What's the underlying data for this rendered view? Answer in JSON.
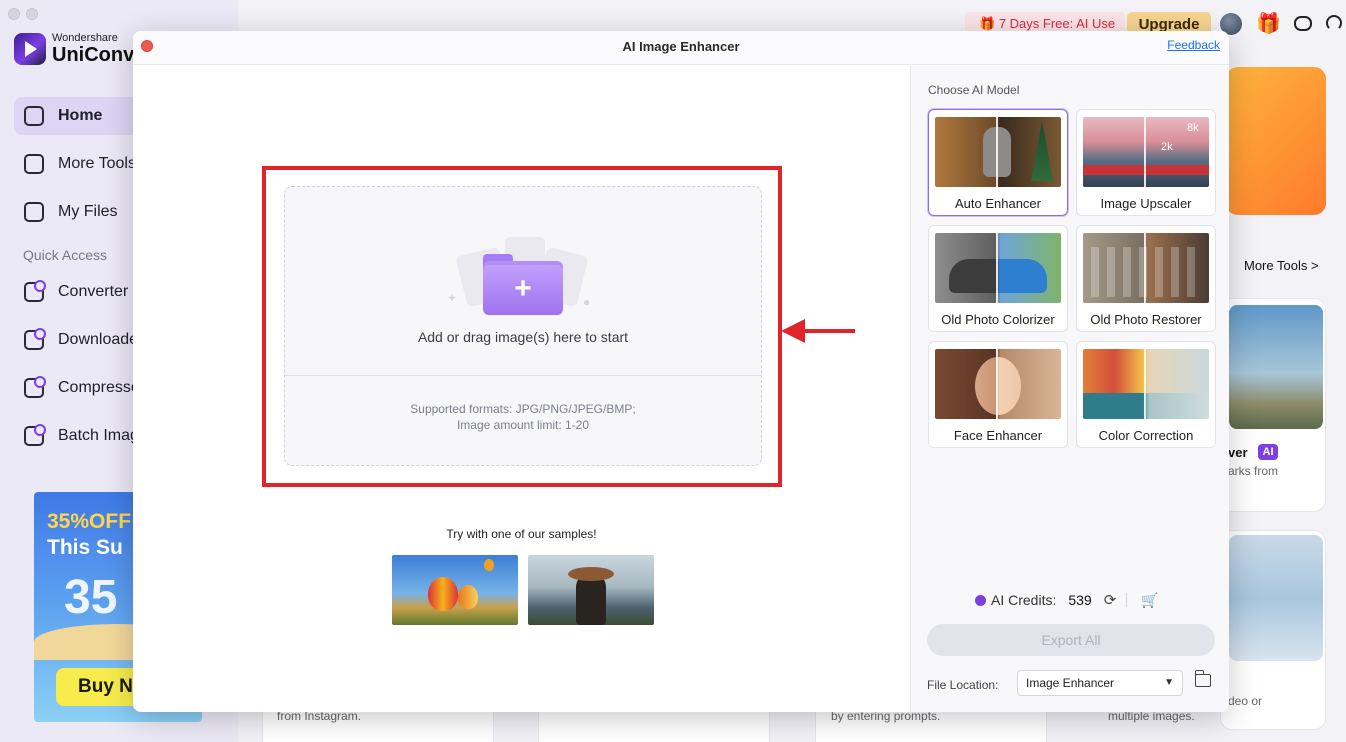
{
  "app": {
    "brand_small": "Wondershare",
    "brand_big": "UniConve"
  },
  "sidebar": {
    "items": [
      {
        "label": "Home"
      },
      {
        "label": "More Tools"
      },
      {
        "label": "My Files"
      }
    ],
    "quick_access_label": "Quick Access",
    "quick_items": [
      {
        "label": "Converter"
      },
      {
        "label": "Downloade"
      },
      {
        "label": "Compresso"
      },
      {
        "label": "Batch Imag"
      }
    ],
    "promo": {
      "line1": "35%OFF",
      "line2": "This Su",
      "big": "35",
      "button": "Buy N"
    }
  },
  "topbar": {
    "trial_label": "7 Days Free: AI Use",
    "upgrade_label": "Upgrade"
  },
  "background": {
    "more_tools_link": "More Tools >",
    "card_title_partial": "ver",
    "card_badge": "AI",
    "card_text_1": "arks from",
    "bottom_text_1": "from Instagram.",
    "bottom_text_2": "by entering prompts.",
    "bottom_text_3": "deo or",
    "bottom_text_4": "multiple images."
  },
  "modal": {
    "title": "AI Image Enhancer",
    "feedback": "Feedback",
    "drop_text": "Add or drag image(s) here to start",
    "formats": "Supported formats: JPG/PNG/JPEG/BMP;",
    "limit": "Image amount limit: 1-20",
    "samples_label": "Try with one of our samples!"
  },
  "models": {
    "section_label": "Choose AI Model",
    "items": [
      {
        "label": "Auto Enhancer",
        "selected": true
      },
      {
        "label": "Image Upscaler",
        "selected": false
      },
      {
        "label": "Old Photo Colorizer",
        "selected": false
      },
      {
        "label": "Old Photo Restorer",
        "selected": false
      },
      {
        "label": "Face Enhancer",
        "selected": false
      },
      {
        "label": "Color Correction",
        "selected": false
      }
    ],
    "upscaler_tags": [
      "8k",
      "2k"
    ]
  },
  "footer": {
    "credits_label": "AI Credits:",
    "credits_value": "539",
    "export_label": "Export All",
    "file_location_label": "File Location:",
    "file_location_value": "Image Enhancer"
  },
  "colors": {
    "accent": "#7b3fe4",
    "highlight_red": "#e0242b",
    "trial_red": "#d62a45",
    "upgrade_bg": "#f6d48f"
  },
  "icons": [
    "gift-icon",
    "avatar",
    "chat-icon",
    "headset-icon",
    "refresh-icon",
    "cart-icon",
    "folder-icon",
    "chevron-down-icon"
  ]
}
